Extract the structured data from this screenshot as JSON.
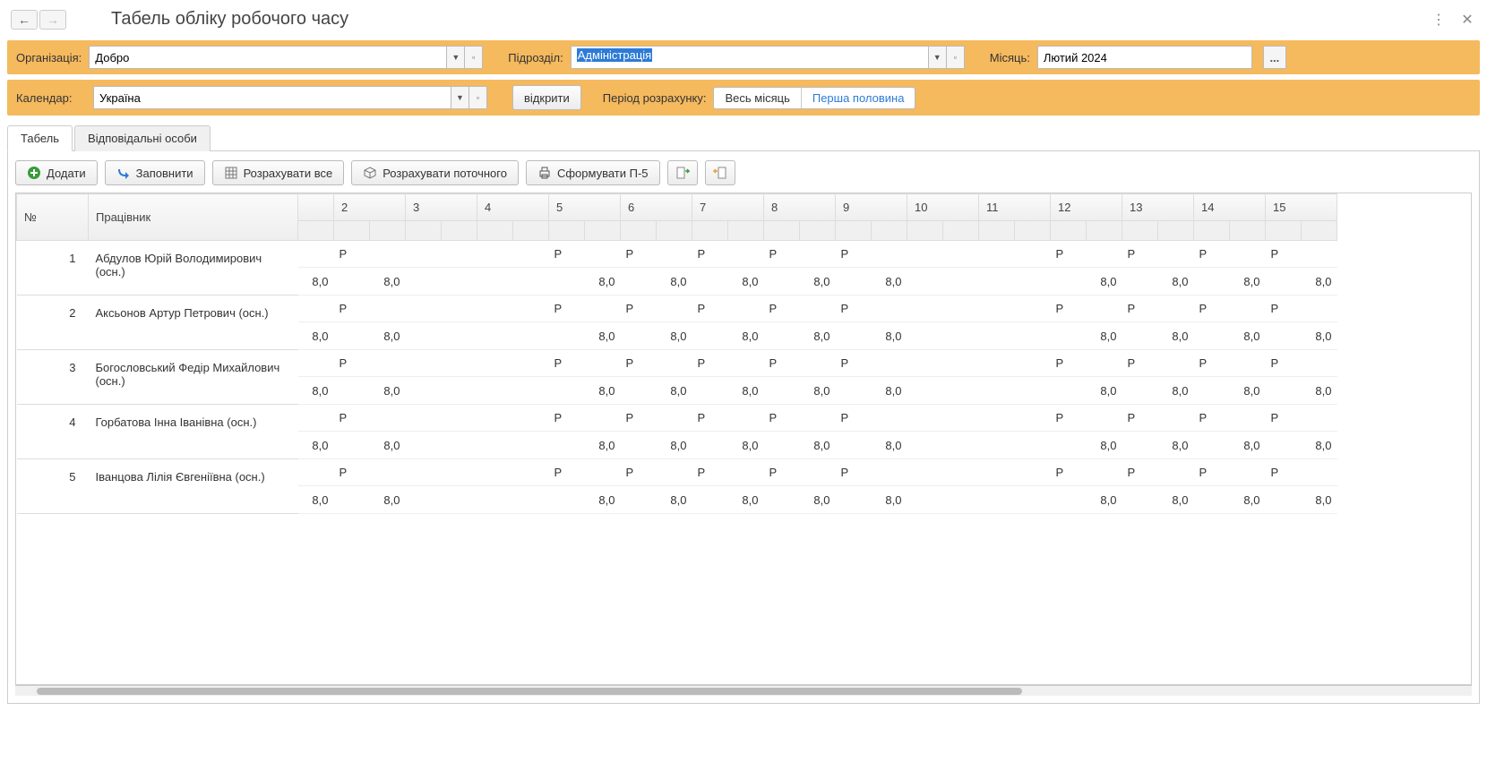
{
  "header": {
    "title": "Табель обліку робочого часу"
  },
  "filters": {
    "org_label": "Організація:",
    "org_value": "Добро",
    "division_label": "Підрозділ:",
    "division_value": "Адміністрація",
    "month_label": "Місяць:",
    "month_value": "Лютий 2024",
    "calendar_label": "Календар:",
    "calendar_value": "Україна",
    "open_btn": "відкрити",
    "period_label": "Період розрахунку:",
    "period_full": "Весь місяць",
    "period_half": "Перша половина"
  },
  "tabs": [
    {
      "label": "Табель",
      "active": true
    },
    {
      "label": "Відповідальні особи",
      "active": false
    }
  ],
  "toolbar": {
    "add": "Додати",
    "fill": "Заповнити",
    "calc_all": "Розрахувати все",
    "calc_current": "Розрахувати поточного",
    "form_p5": "Сформувати П-5"
  },
  "grid": {
    "headers": {
      "num": "№",
      "employee": "Працівник"
    },
    "days": [
      "",
      "2",
      "3",
      "4",
      "5",
      "6",
      "7",
      "8",
      "9",
      "10",
      "11",
      "12",
      "13",
      "14",
      "15"
    ],
    "work_code": "Р",
    "hours": "8,0",
    "rows": [
      {
        "n": "1",
        "emp": "Абдулов Юрій Володимирович (осн.)",
        "cells": [
          {
            "c": "",
            "h": "8,0"
          },
          {
            "c": "Р",
            "h": "8,0"
          },
          {
            "c": "",
            "h": ""
          },
          {
            "c": "",
            "h": ""
          },
          {
            "c": "Р",
            "h": "8,0"
          },
          {
            "c": "Р",
            "h": "8,0"
          },
          {
            "c": "Р",
            "h": "8,0"
          },
          {
            "c": "Р",
            "h": "8,0"
          },
          {
            "c": "Р",
            "h": "8,0"
          },
          {
            "c": "",
            "h": ""
          },
          {
            "c": "",
            "h": ""
          },
          {
            "c": "Р",
            "h": "8,0"
          },
          {
            "c": "Р",
            "h": "8,0"
          },
          {
            "c": "Р",
            "h": "8,0"
          },
          {
            "c": "Р",
            "h": "8,0"
          }
        ]
      },
      {
        "n": "2",
        "emp": "Аксьонов Артур Петрович (осн.)",
        "cells": [
          {
            "c": "",
            "h": "8,0"
          },
          {
            "c": "Р",
            "h": "8,0"
          },
          {
            "c": "",
            "h": ""
          },
          {
            "c": "",
            "h": ""
          },
          {
            "c": "Р",
            "h": "8,0"
          },
          {
            "c": "Р",
            "h": "8,0"
          },
          {
            "c": "Р",
            "h": "8,0"
          },
          {
            "c": "Р",
            "h": "8,0"
          },
          {
            "c": "Р",
            "h": "8,0"
          },
          {
            "c": "",
            "h": ""
          },
          {
            "c": "",
            "h": ""
          },
          {
            "c": "Р",
            "h": "8,0"
          },
          {
            "c": "Р",
            "h": "8,0"
          },
          {
            "c": "Р",
            "h": "8,0"
          },
          {
            "c": "Р",
            "h": "8,0"
          }
        ]
      },
      {
        "n": "3",
        "emp": "Богословський Федір Михайлович (осн.)",
        "cells": [
          {
            "c": "",
            "h": "8,0"
          },
          {
            "c": "Р",
            "h": "8,0"
          },
          {
            "c": "",
            "h": ""
          },
          {
            "c": "",
            "h": ""
          },
          {
            "c": "Р",
            "h": "8,0"
          },
          {
            "c": "Р",
            "h": "8,0"
          },
          {
            "c": "Р",
            "h": "8,0"
          },
          {
            "c": "Р",
            "h": "8,0"
          },
          {
            "c": "Р",
            "h": "8,0"
          },
          {
            "c": "",
            "h": ""
          },
          {
            "c": "",
            "h": ""
          },
          {
            "c": "Р",
            "h": "8,0"
          },
          {
            "c": "Р",
            "h": "8,0"
          },
          {
            "c": "Р",
            "h": "8,0"
          },
          {
            "c": "Р",
            "h": "8,0"
          }
        ]
      },
      {
        "n": "4",
        "emp": "Горбатова Інна Іванівна (осн.)",
        "cells": [
          {
            "c": "",
            "h": "8,0"
          },
          {
            "c": "Р",
            "h": "8,0"
          },
          {
            "c": "",
            "h": ""
          },
          {
            "c": "",
            "h": ""
          },
          {
            "c": "Р",
            "h": "8,0"
          },
          {
            "c": "Р",
            "h": "8,0"
          },
          {
            "c": "Р",
            "h": "8,0"
          },
          {
            "c": "Р",
            "h": "8,0"
          },
          {
            "c": "Р",
            "h": "8,0"
          },
          {
            "c": "",
            "h": ""
          },
          {
            "c": "",
            "h": ""
          },
          {
            "c": "Р",
            "h": "8,0"
          },
          {
            "c": "Р",
            "h": "8,0"
          },
          {
            "c": "Р",
            "h": "8,0"
          },
          {
            "c": "Р",
            "h": "8,0"
          }
        ]
      },
      {
        "n": "5",
        "emp": "Іванцова Лілія Євгеніївна (осн.)",
        "cells": [
          {
            "c": "",
            "h": "8,0"
          },
          {
            "c": "Р",
            "h": "8,0"
          },
          {
            "c": "",
            "h": ""
          },
          {
            "c": "",
            "h": ""
          },
          {
            "c": "Р",
            "h": "8,0"
          },
          {
            "c": "Р",
            "h": "8,0"
          },
          {
            "c": "Р",
            "h": "8,0"
          },
          {
            "c": "Р",
            "h": "8,0"
          },
          {
            "c": "Р",
            "h": "8,0"
          },
          {
            "c": "",
            "h": ""
          },
          {
            "c": "",
            "h": ""
          },
          {
            "c": "Р",
            "h": "8,0"
          },
          {
            "c": "Р",
            "h": "8,0"
          },
          {
            "c": "Р",
            "h": "8,0"
          },
          {
            "c": "Р",
            "h": "8,0"
          }
        ]
      }
    ]
  }
}
